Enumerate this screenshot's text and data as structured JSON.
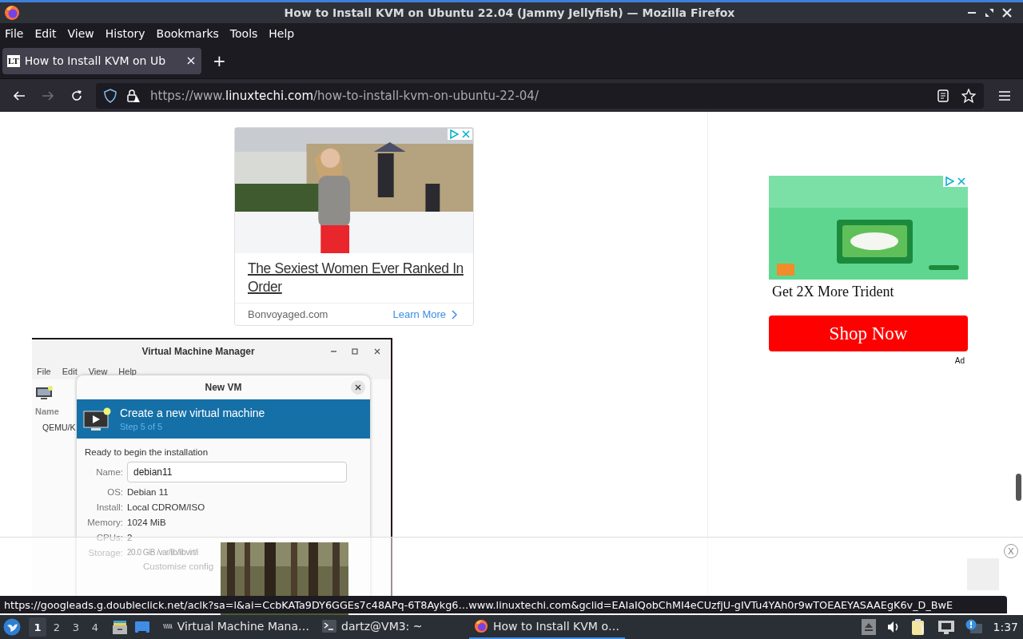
{
  "window": {
    "title": "How to Install KVM on Ubuntu 22.04 (Jammy Jellyfish) — Mozilla Firefox"
  },
  "menu": [
    "File",
    "Edit",
    "View",
    "History",
    "Bookmarks",
    "Tools",
    "Help"
  ],
  "tabs": [
    {
      "favicon": "LT",
      "label": "How to Install KVM on Ub",
      "selected": true
    }
  ],
  "new_tab": "+",
  "address": {
    "scheme": "https://www.",
    "domain": "linuxtechi.com",
    "path": "/how-to-install-kvm-on-ubuntu-22-04/"
  },
  "ad_card": {
    "headline": "The Sexiest Women Ever Ranked In Order",
    "source": "Bonvoyaged.com",
    "cta": "Learn More"
  },
  "side_ad": {
    "caption": "Get 2X More Trident",
    "button": "Shop Now",
    "label": "Ad"
  },
  "screenshot": {
    "title": "Virtual Machine Manager",
    "menu": [
      "File",
      "Edit",
      "View",
      "Help"
    ],
    "column": "Name",
    "row": "QEMU/K",
    "dialog": {
      "title": "New VM",
      "heading": "Create a new virtual machine",
      "step": "Step 5 of 5",
      "intro": "Ready to begin the installation",
      "name_label": "Name:",
      "name_value": "debian11",
      "fields": [
        {
          "label": "OS:",
          "value": "Debian 11"
        },
        {
          "label": "Install:",
          "value": "Local CDROM/ISO"
        },
        {
          "label": "Memory:",
          "value": "1024 MiB"
        },
        {
          "label": "CPUs:",
          "value": "2"
        },
        {
          "label": "Storage:",
          "value": "20.0 GiB /var/lib/libvirt/i"
        }
      ],
      "customise": "Customise config"
    }
  },
  "bottom_ad": {
    "close": "X"
  },
  "status_url": "https://googleads.g.doubleclick.net/aclk?sa=l&ai=CcbKATa9DY6GGEs7c48APq-6T8Aykg6…www.linuxtechi.com&gclid=EAIaIQobChMI4eCUzfjU-gIVTu4YAh0r9wTOEAEYASAAEgK6v_D_BwE",
  "taskbar": {
    "workspaces": [
      {
        "label": "1",
        "selected": true
      },
      {
        "label": "2",
        "selected": false
      },
      {
        "label": "3",
        "selected": false
      },
      {
        "label": "4",
        "selected": false
      }
    ],
    "tasks": [
      {
        "kind": "vm",
        "label": "Virtual Machine Mana…",
        "selected": false
      },
      {
        "kind": "terminal",
        "label": "dartz@VM3: ~",
        "selected": false
      },
      {
        "kind": "browser",
        "label": "How to Install KVM o…",
        "selected": true
      }
    ],
    "clock": "1:37"
  }
}
